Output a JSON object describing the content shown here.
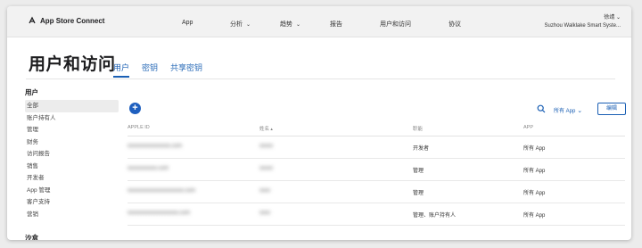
{
  "header": {
    "brand": "App Store Connect",
    "nav": [
      "App",
      "分析",
      "趋势",
      "报告",
      "用户和访问",
      "协议"
    ],
    "account_name": "徐靖",
    "account_org": "Suzhou Walklake Smart Syste..."
  },
  "page": {
    "title": "用户和访问",
    "tabs": [
      "用户",
      "密钥",
      "共享密钥"
    ]
  },
  "sidebar": {
    "heading": "用户",
    "items": [
      "全部",
      "账户持有人",
      "管理",
      "财务",
      "访问报告",
      "销售",
      "开发者",
      "App 管理",
      "客户支持",
      "营销"
    ],
    "heading2": "沙盒"
  },
  "toolbar": {
    "add_label": "+",
    "filter_label": "所有 App",
    "edit_label": "编辑"
  },
  "table": {
    "headers": [
      "APPLE ID",
      "姓名",
      "职能",
      "APP"
    ],
    "rows": [
      {
        "apple_id": "xxxxxxxxxxxxxxxx.com",
        "name": "xxxxx",
        "role": "开发者",
        "app": "所有 App"
      },
      {
        "apple_id": "xxxxxxxxxxx.com",
        "name": "xxxxx",
        "role": "管理",
        "app": "所有 App"
      },
      {
        "apple_id": "xxxxxxxxxxxxxxxxxxxxx.com",
        "name": "xxxx",
        "role": "管理",
        "app": "所有 App"
      },
      {
        "apple_id": "xxxxxxxxxxxxxxxxxxx.com",
        "name": "xxxx",
        "role": "管理、账户持有人",
        "app": "所有 App"
      }
    ]
  },
  "colors": {
    "accent": "#1a5fb4",
    "add_button": "#1e5fbf"
  }
}
